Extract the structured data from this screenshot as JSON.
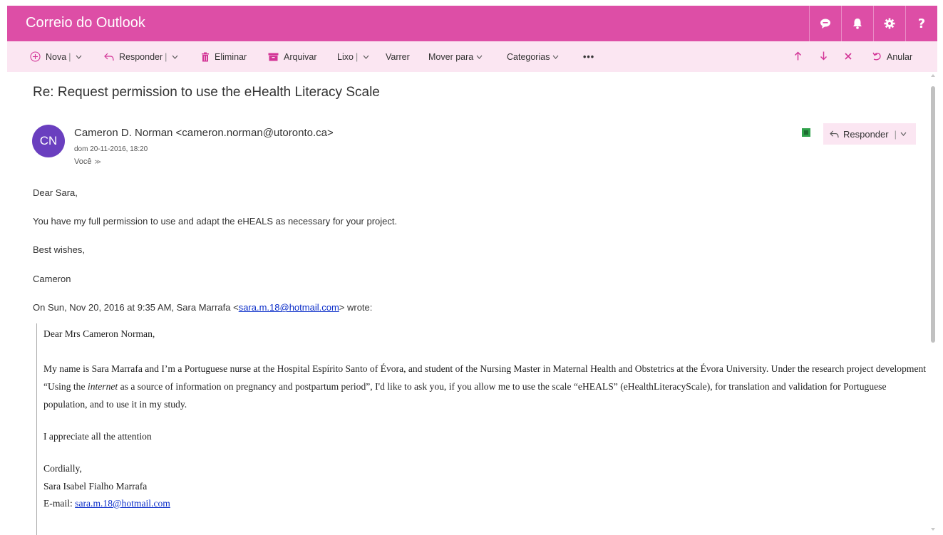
{
  "header": {
    "title": "Correio do Outlook",
    "bg_color": "#dd4ea6",
    "icons": [
      "chat-icon",
      "bell-icon",
      "gear-icon",
      "help-icon"
    ],
    "help_glyph": "?"
  },
  "toolbar": {
    "bg_color": "#fbe6f2",
    "nova": "Nova",
    "responder": "Responder",
    "eliminar": "Eliminar",
    "arquivar": "Arquivar",
    "lixo": "Lixo",
    "varrer": "Varrer",
    "mover_para": "Mover para",
    "categorias": "Categorias",
    "more": "•••",
    "anular": "Anular",
    "separator": "|"
  },
  "message": {
    "subject": "Re: Request permission to use the eHealth Literacy Scale",
    "avatar_initials": "CN",
    "avatar_color": "#6a3fbf",
    "sender": "Cameron D. Norman <cameron.norman@utoronto.ca>",
    "date": "dom 20-11-2016, 18:20",
    "to": "Você",
    "reply_label": "Responder",
    "body": {
      "greeting": "Dear Sara,",
      "line1": "You have my full permission to use and adapt the eHEALS as necessary for your project.",
      "closing": "Best wishes,",
      "signature": "Cameron",
      "quote_header_prefix": "On Sun, Nov 20, 2016 at 9:35 AM, Sara Marrafa <",
      "quote_header_email": "sara.m.18@hotmail.com",
      "quote_header_suffix": "> wrote:"
    },
    "quoted": {
      "greeting": "Dear Mrs Cameron Norman,",
      "p1_a": "My name is Sara Marrafa and I’m a Portuguese nurse at the Hospital Espírito Santo of Évora, and student of the Nursing Master in Maternal Health and Obstetrics at the Évora University. Under the research project development “Using the ",
      "p1_em": "internet",
      "p1_b": " as a source of information on pregnancy and postpartum period”, I'd like to ask you, if you allow me to use the scale “eHEALS” (eHealthLiteracyScale), for translation and validation for Portuguese population, and to use it in my study.",
      "appreciate": "I appreciate all the attention",
      "cordially": "Cordially,",
      "name": "Sara Isabel Fialho Marrafa",
      "email_label": "E-mail: ",
      "email": "sara.m.18@hotmail.com"
    }
  }
}
